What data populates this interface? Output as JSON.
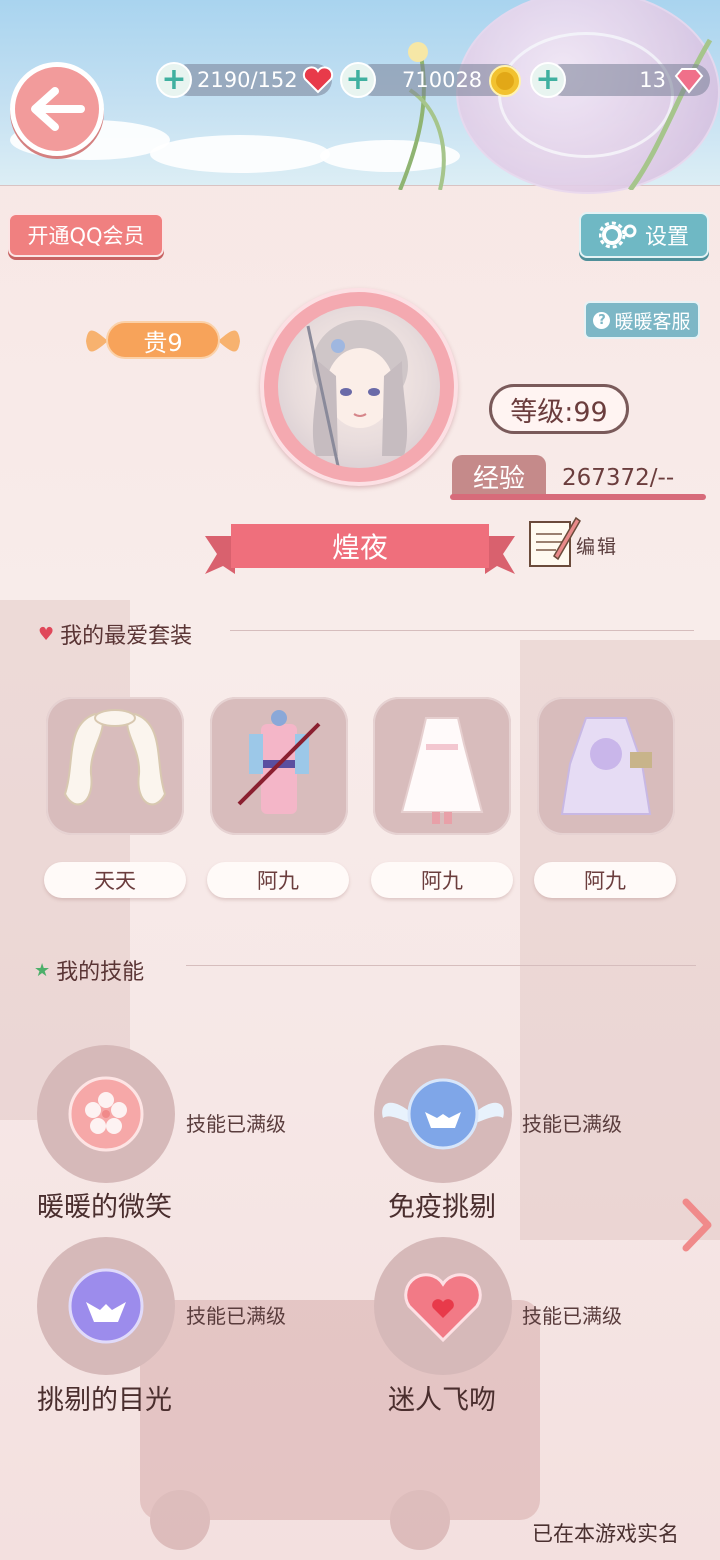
{
  "resources": {
    "stamina": "2190/152",
    "coins": "710028",
    "diamonds": "13"
  },
  "buttons": {
    "qq_vip": "开通QQ会员",
    "settings": "设置",
    "customer_service": "暖暖客服",
    "edit": "编辑"
  },
  "profile": {
    "vip_level": "贵9",
    "level": "等级:99",
    "exp_label": "经验",
    "exp_value": "267372/--",
    "nickname": "煌夜"
  },
  "favorites": {
    "title": "我的最爱套装",
    "items": [
      {
        "label": "天天"
      },
      {
        "label": "阿九"
      },
      {
        "label": "阿九"
      },
      {
        "label": "阿九"
      }
    ]
  },
  "skills": {
    "title": "我的技能",
    "items": [
      {
        "name": "暖暖的微笑",
        "status": "技能已满级",
        "icon": "sakura-icon"
      },
      {
        "name": "免疫挑剔",
        "status": "技能已满级",
        "icon": "winged-mask-icon"
      },
      {
        "name": "挑剔的目光",
        "status": "技能已满级",
        "icon": "mask-icon"
      },
      {
        "name": "迷人飞吻",
        "status": "技能已满级",
        "icon": "heart-icon"
      }
    ]
  },
  "footer": {
    "realname": "已在本游戏实名"
  },
  "colors": {
    "accent_pink": "#f08080",
    "teal": "#6fb8c4",
    "vip_orange": "#f7a35a"
  }
}
